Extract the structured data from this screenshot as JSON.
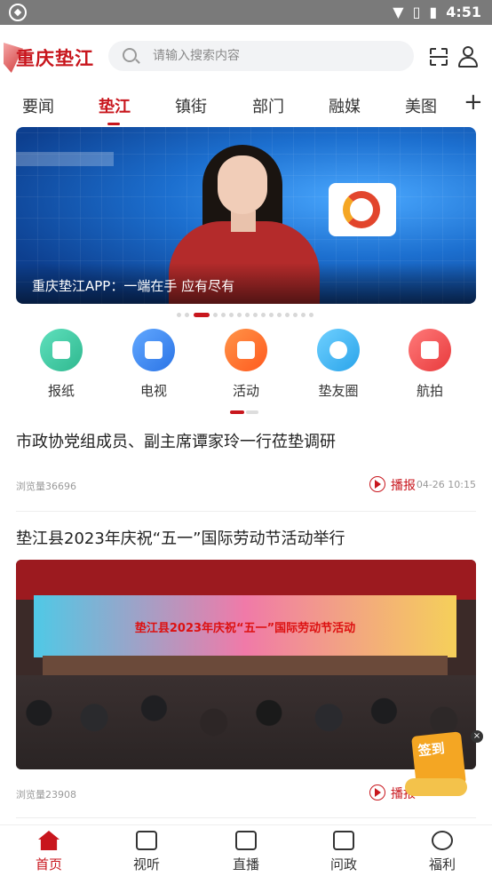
{
  "status_bar": {
    "time": "4:51"
  },
  "header": {
    "logo": "重庆垫江",
    "search_placeholder": "请输入搜索内容"
  },
  "tabs": [
    {
      "label": "要闻"
    },
    {
      "label": "垫江"
    },
    {
      "label": "镇街"
    },
    {
      "label": "部门"
    },
    {
      "label": "融媒"
    },
    {
      "label": "美图"
    }
  ],
  "active_tab": "垫江",
  "banner": {
    "caption": "重庆垫江APP：一端在手 应有尽有"
  },
  "quick_icons": [
    {
      "label": "报纸",
      "icon": "newspaper-icon",
      "color": "#3dc9a4"
    },
    {
      "label": "电视",
      "icon": "tv-icon",
      "color": "#3b8cf0"
    },
    {
      "label": "活动",
      "icon": "activity-icon",
      "color": "#ff6b2c"
    },
    {
      "label": "垫友圈",
      "icon": "camera-aperture-icon",
      "color": "#36b3f0"
    },
    {
      "label": "航拍",
      "icon": "drone-icon",
      "color": "#f0484a"
    }
  ],
  "news": [
    {
      "title": "市政协党组成员、副主席谭家玲一行莅垫调研",
      "views": "浏览量36696",
      "broadcast": "播报",
      "time": "04-26 10:15"
    },
    {
      "title": "垫江县2023年庆祝“五一”国际劳动节活动举行",
      "views": "浏览量23908",
      "broadcast": "播报",
      "photo_caption": "垫江县2023年庆祝“五一”国际劳动节活动"
    }
  ],
  "checkin": {
    "label": "签到"
  },
  "bottom_nav": [
    {
      "label": "首页"
    },
    {
      "label": "视听"
    },
    {
      "label": "直播"
    },
    {
      "label": "问政"
    },
    {
      "label": "福利"
    }
  ],
  "colors": {
    "brand": "#c8161d",
    "status_bar": "#7a7a7a"
  }
}
